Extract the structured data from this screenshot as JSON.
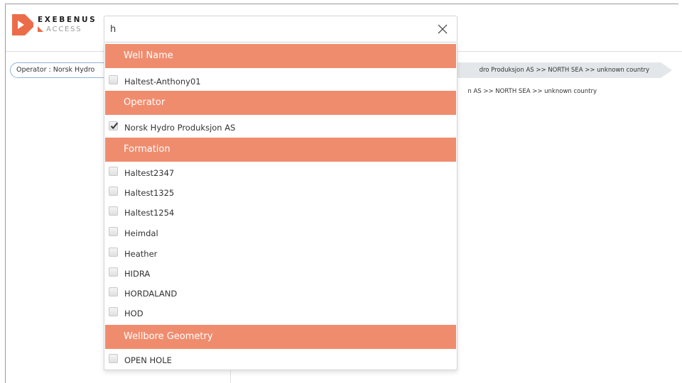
{
  "brand": {
    "name": "EXEBENUS",
    "sub": "ACCESS",
    "accent_color": "#ec6c4a"
  },
  "breadcrumb": {
    "pill_label": "Operator : Norsk Hydro",
    "trail": "dro Produksjon AS >> NORTH SEA >> unknown country",
    "sub_trail": "n AS >> NORTH SEA >> unknown country"
  },
  "search": {
    "value": "h",
    "clear_icon": "close-icon"
  },
  "dropdown": {
    "header_color": "#f08c6e",
    "groups": [
      {
        "title": "Well Name",
        "options": [
          {
            "label": "Haltest-Anthony01",
            "checked": false
          }
        ]
      },
      {
        "title": "Operator",
        "options": [
          {
            "label": "Norsk Hydro Produksjon AS",
            "checked": true
          }
        ]
      },
      {
        "title": "Formation",
        "options": [
          {
            "label": "Haltest2347",
            "checked": false
          },
          {
            "label": "Haltest1325",
            "checked": false
          },
          {
            "label": "Haltest1254",
            "checked": false
          },
          {
            "label": "Heimdal",
            "checked": false
          },
          {
            "label": "Heather",
            "checked": false
          },
          {
            "label": "HIDRA",
            "checked": false
          },
          {
            "label": "HORDALAND",
            "checked": false
          },
          {
            "label": "HOD",
            "checked": false
          }
        ]
      },
      {
        "title": "Wellbore Geometry",
        "options": [
          {
            "label": "OPEN HOLE",
            "checked": false
          }
        ]
      }
    ]
  }
}
